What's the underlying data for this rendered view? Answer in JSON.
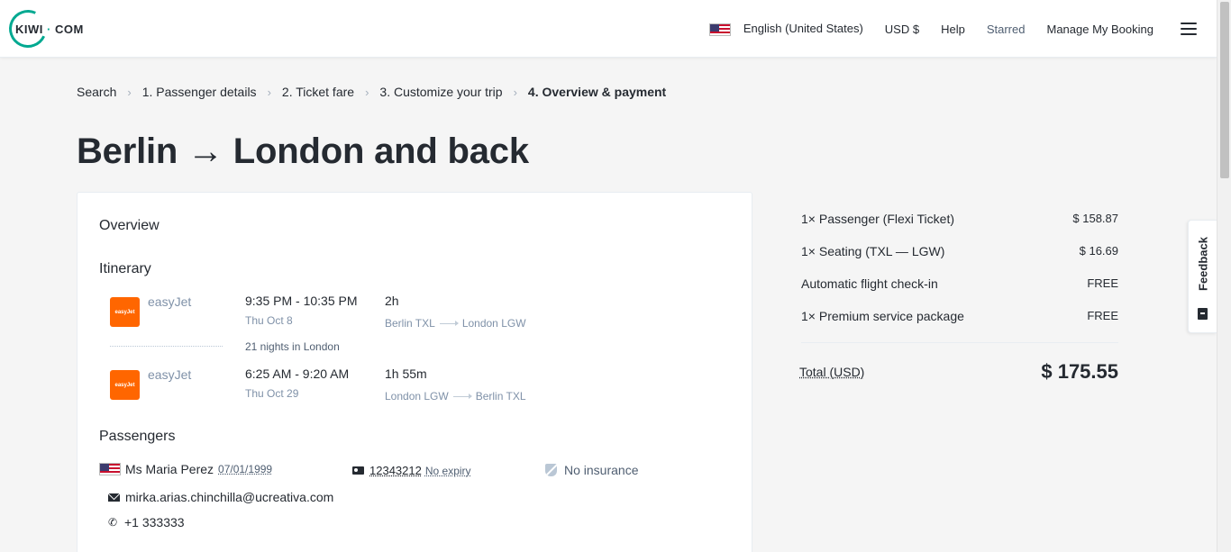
{
  "header": {
    "logo_text": "KIWI",
    "logo_dot": "·",
    "logo_suffix": "COM",
    "language": "English (United States)",
    "currency": "USD $",
    "help": "Help",
    "starred": "Starred",
    "manage_booking": "Manage My Booking"
  },
  "breadcrumb": {
    "items": [
      "Search",
      "1. Passenger details",
      "2. Ticket fare",
      "3. Customize your trip",
      "4. Overview & payment"
    ],
    "separator": "›"
  },
  "page_title": "Berlin → London and back",
  "overview": {
    "title": "Overview",
    "itinerary_title": "Itinerary",
    "segments": [
      {
        "airline": "easyJet",
        "airline_logo_text": "easyJet",
        "times": "9:35 PM - 10:35 PM",
        "date": "Thu Oct 8",
        "duration": "2h",
        "from": "Berlin TXL",
        "to": "London LGW"
      },
      {
        "airline": "easyJet",
        "airline_logo_text": "easyJet",
        "times": "6:25 AM - 9:20 AM",
        "date": "Thu Oct 29",
        "duration": "1h 55m",
        "from": "London LGW",
        "to": "Berlin TXL"
      }
    ],
    "stay_text": "21 nights in London",
    "passengers_title": "Passengers",
    "passenger": {
      "name": "Ms Maria Perez",
      "dob": "07/01/1999",
      "id_number": "12343212",
      "id_expiry": "No expiry",
      "insurance": "No insurance",
      "email": "mirka.arias.chinchilla@ucreativa.com",
      "phone": "+1 333333"
    }
  },
  "price_summary": {
    "rows": [
      {
        "label": "1× Passenger (Flexi Ticket)",
        "amount": "$ 158.87"
      },
      {
        "label": "1× Seating (TXL — LGW)",
        "amount": "$ 16.69"
      },
      {
        "label": "Automatic flight check-in",
        "amount": "FREE"
      },
      {
        "label": "1× Premium service package",
        "amount": "FREE"
      }
    ],
    "total_label": "Total (USD)",
    "total_value": "$ 175.55"
  },
  "feedback": {
    "label": "Feedback"
  },
  "colors": {
    "brand": "#00a991",
    "easyjet": "#ff6600",
    "text": "#252a31",
    "muted": "#7f91a8"
  }
}
